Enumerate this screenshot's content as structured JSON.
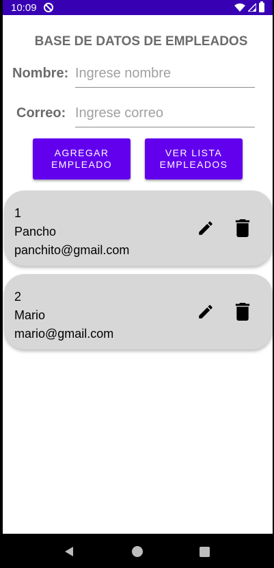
{
  "status_bar": {
    "time": "10:09",
    "icons": [
      "notification-blocked-icon",
      "wifi-icon",
      "signal-icon",
      "battery-icon"
    ]
  },
  "app": {
    "title": "BASE DE DATOS DE EMPLEADOS",
    "form": {
      "name_label": "Nombre:",
      "name_placeholder": "Ingrese nombre",
      "name_value": "",
      "email_label": "Correo:",
      "email_placeholder": "Ingrese correo",
      "email_value": ""
    },
    "buttons": {
      "add_label": "AGREGAR EMPLEADO",
      "list_label": "VER LISTA EMPLEADOS"
    },
    "employees": [
      {
        "id": "1",
        "name": "Pancho",
        "email": "panchito@gmail.com"
      },
      {
        "id": "2",
        "name": "Mario",
        "email": "mario@gmail.com"
      }
    ]
  },
  "colors": {
    "status_bar": "#3700B3",
    "button": "#6200EE",
    "card": "#D7D7D7",
    "label_gray": "#6B6B6B"
  },
  "nav_bar": {
    "icons": [
      "back-icon",
      "home-icon",
      "recents-icon"
    ]
  }
}
